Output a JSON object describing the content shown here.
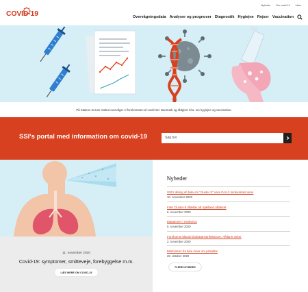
{
  "utility_nav": [
    "Nyheder",
    "Om covid-19",
    "Links"
  ],
  "logo": {
    "text": "COVID-19"
  },
  "nav": {
    "items": [
      "Overvågningsdata",
      "Analyser og prognoser",
      "Diagnostik",
      "Hygiejne",
      "Rejser",
      "Vaccination"
    ]
  },
  "hero": {
    "caption": "På Statens Serum Institut overvåger vi forekomsten af covid-19 i Danmark og rådgiver bl.a. om hygiejne og vaccination."
  },
  "band": {
    "title": "SSI's portal med information om covid-19",
    "search_placeholder": "Søg her"
  },
  "feature": {
    "date": "11. november 2020",
    "title": "Covid-19: symptomer, smitteveje, forebyggelse m.m.",
    "button": "LÆS MERE OM COVID-19"
  },
  "news": {
    "heading": "Nyheder",
    "items": [
      {
        "title": "SSI's deling af data om \"cluster 5\" vars-CoV-2 minkvariant virus",
        "date": "10. november 2020"
      },
      {
        "title": "Intet Cluster-5 tilfælde på Sjælland afdæset",
        "date": "6. november 2020"
      },
      {
        "title": "Mutationer i minkvirus",
        "date": "5. november 2020"
      },
      {
        "title": "Forekomst blandt blodstrømsinfektioner: Afklaret virker",
        "date": "2. november 2020"
      },
      {
        "title": "Minkvirens fra ikke inner om prisaktie",
        "date": "28. oktober 2020"
      }
    ],
    "more_button": "FLERE NYHEDER"
  },
  "colors": {
    "brand": "#d33a1c",
    "band": "#d8411f",
    "hero_bg": "#d6eff7",
    "card_bg": "#ececec"
  }
}
